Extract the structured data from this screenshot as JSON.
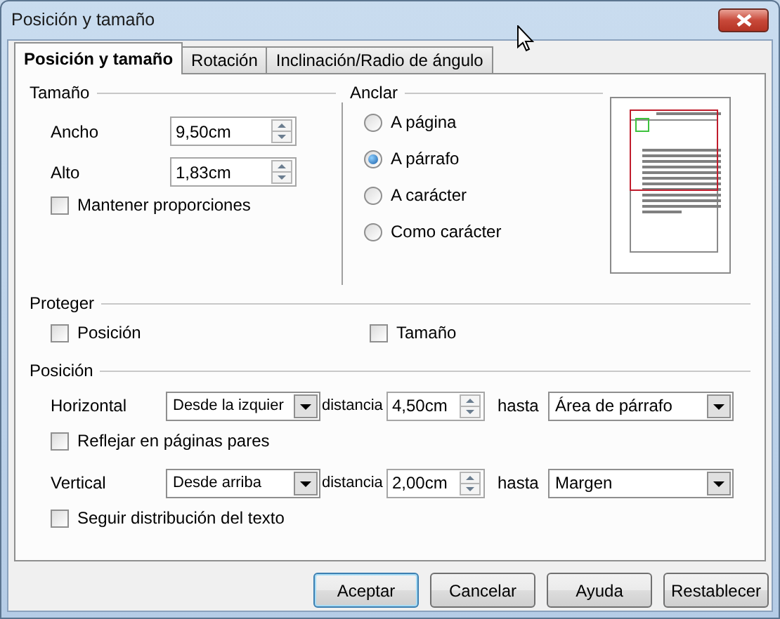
{
  "window": {
    "title": "Posición y tamaño"
  },
  "tabs": [
    {
      "label": "Posición y tamaño",
      "selected": true
    },
    {
      "label": "Rotación",
      "selected": false
    },
    {
      "label": "Inclinación/Radio de ángulo",
      "selected": false
    }
  ],
  "size": {
    "heading": "Tamaño",
    "fields": [
      {
        "label": "Ancho",
        "value": "9,50cm"
      },
      {
        "label": "Alto",
        "value": "1,83cm"
      }
    ],
    "keep_ratio": {
      "label": "Mantener proporciones",
      "checked": false
    }
  },
  "anchor": {
    "heading": "Anclar",
    "options": [
      {
        "label": "A página",
        "selected": false
      },
      {
        "label": "A párrafo",
        "selected": true
      },
      {
        "label": "A carácter",
        "selected": false
      },
      {
        "label": "Como carácter",
        "selected": false
      }
    ]
  },
  "protect": {
    "heading": "Proteger",
    "options": [
      {
        "label": "Posición",
        "checked": false
      },
      {
        "label": "Tamaño",
        "checked": false
      }
    ]
  },
  "position": {
    "heading": "Posición",
    "rows": [
      {
        "label": "Horizontal",
        "from": "Desde la izquier",
        "distance_label": "distancia",
        "distance": "4,50cm",
        "to_label": "hasta",
        "to": "Área de párrafo",
        "option": {
          "label": "Reflejar en páginas pares",
          "checked": false
        }
      },
      {
        "label": "Vertical",
        "from": "Desde arriba",
        "distance_label": "distancia",
        "distance": "2,00cm",
        "to_label": "hasta",
        "to": "Margen",
        "option": {
          "label": "Seguir distribución del texto",
          "checked": false
        }
      }
    ]
  },
  "buttons": [
    {
      "label": "Aceptar",
      "default": true
    },
    {
      "label": "Cancelar",
      "default": false
    },
    {
      "label": "Ayuda",
      "default": false
    },
    {
      "label": "Restablecer",
      "default": false
    }
  ]
}
